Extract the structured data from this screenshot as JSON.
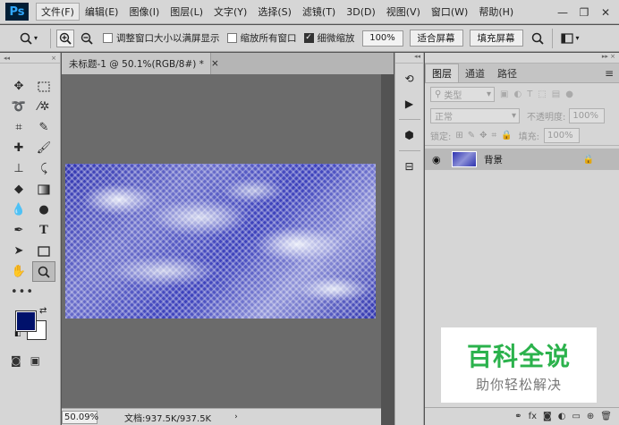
{
  "app": {
    "logo": "Ps"
  },
  "menu": [
    {
      "label": "文件(F)",
      "active": true
    },
    {
      "label": "编辑(E)"
    },
    {
      "label": "图像(I)"
    },
    {
      "label": "图层(L)"
    },
    {
      "label": "文字(Y)"
    },
    {
      "label": "选择(S)"
    },
    {
      "label": "滤镜(T)"
    },
    {
      "label": "3D(D)"
    },
    {
      "label": "视图(V)"
    },
    {
      "label": "窗口(W)"
    },
    {
      "label": "帮助(H)"
    }
  ],
  "options": {
    "resize_windows_label": "调整窗口大小以满屏显示",
    "zoom_all_label": "缩放所有窗口",
    "scrubby_zoom_label": "细微缩放",
    "zoom_value": "100%",
    "fit_screen_label": "适合屏幕",
    "fill_screen_label": "填充屏幕"
  },
  "document": {
    "tab_title": "未标题-1 @ 50.1%(RGB/8#) *",
    "close_glyph": "×",
    "status_zoom": "50.09%",
    "status_doc": "文档:937.5K/937.5K",
    "status_arrow": "›"
  },
  "colors": {
    "foreground": "#00116b",
    "background": "#ffffff"
  },
  "layers_panel": {
    "tabs": [
      "图层",
      "通道",
      "路径"
    ],
    "filter_label": "类型",
    "blend_mode": "正常",
    "opacity_label": "不透明度:",
    "opacity_value": "100%",
    "lock_label": "锁定:",
    "fill_label": "填充:",
    "fill_value": "100%",
    "layer_name": "背景"
  },
  "watermark": {
    "title": "百科全说",
    "subtitle": "助你轻松解决"
  }
}
